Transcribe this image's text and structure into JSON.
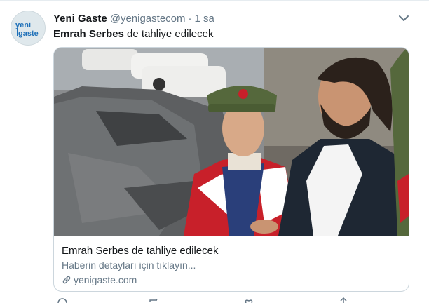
{
  "tweet": {
    "author_name": "Yeni Gaste",
    "handle": "@yenigastecom",
    "separator": "·",
    "time": "1 sa",
    "text_bold": "Emrah Serbes",
    "text_rest": " de tahliye edilecek",
    "avatar_logo_text_top": "yeni",
    "avatar_logo_text_bottom": "gaste"
  },
  "card": {
    "title": "Emrah Serbes de tahliye edilecek",
    "description": "Haberin detayları için tıklayın...",
    "domain": "yenigaste.com"
  },
  "icons": {
    "chevron": "chevron-down-icon",
    "link": "link-icon",
    "reply": "reply-icon",
    "retweet": "retweet-icon",
    "like": "heart-icon",
    "share": "share-icon"
  },
  "colors": {
    "text_primary": "#14171a",
    "text_secondary": "#657786",
    "border": "#ccd6dd",
    "logo_blue": "#1d6fb8"
  }
}
